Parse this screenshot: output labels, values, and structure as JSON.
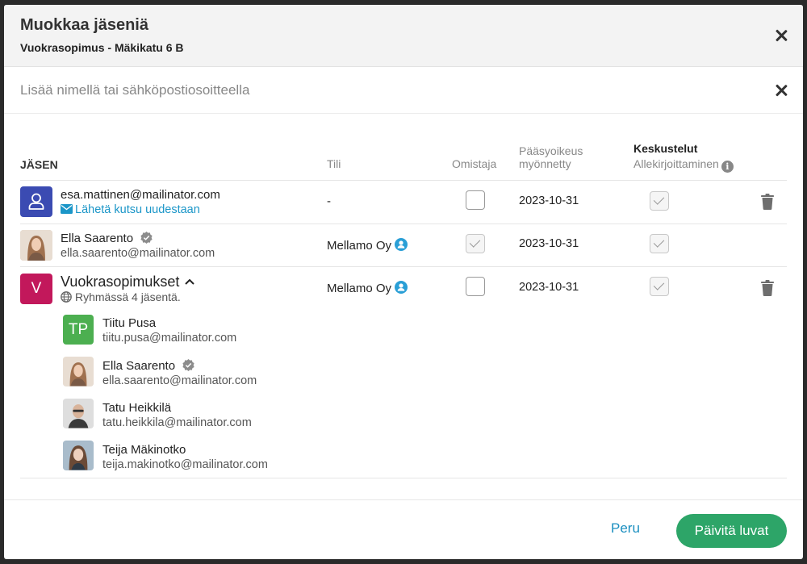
{
  "modal": {
    "title": "Muokkaa jäseniä",
    "subtitle": "Vuokrasopimus - Mäkikatu 6 B"
  },
  "search": {
    "placeholder": "Lisää nimellä tai sähköpostiosoitteella"
  },
  "table": {
    "headers": {
      "member": "JÄSEN",
      "account": "Tili",
      "owner": "Omistaja",
      "access_line1": "Pääsyoikeus",
      "access_line2": "myönnetty",
      "discussions": "Keskustelut",
      "signing": "Allekirjoittaminen"
    },
    "rows": [
      {
        "email": "esa.mattinen@mailinator.com",
        "resend_label": "Lähetä kutsu uudestaan",
        "account": "-",
        "owner_checked": false,
        "date": "2023-10-31",
        "signing_checked": true
      },
      {
        "name": "Ella Saarento",
        "email": "ella.saarento@mailinator.com",
        "account": "Mellamo Oy",
        "owner_checked": true,
        "date": "2023-10-31",
        "signing_checked": true
      },
      {
        "avatar_letter": "V",
        "name": "Vuokrasopimukset",
        "group_info": "Ryhmässä 4 jäsentä.",
        "account": "Mellamo Oy",
        "owner_checked": false,
        "date": "2023-10-31",
        "signing_checked": true
      }
    ],
    "group_members": [
      {
        "initials": "TP",
        "name": "Tiitu Pusa",
        "email": "tiitu.pusa@mailinator.com"
      },
      {
        "name": "Ella Saarento",
        "email": "ella.saarento@mailinator.com"
      },
      {
        "name": "Tatu Heikkilä",
        "email": "tatu.heikkila@mailinator.com"
      },
      {
        "name": "Teija Mäkinotko",
        "email": "teija.makinotko@mailinator.com"
      }
    ]
  },
  "footer": {
    "cancel_label": "Peru",
    "update_label": "Päivitä luvat"
  },
  "colors": {
    "accent_blue": "#1b96c8",
    "primary_green": "#2da568",
    "avatar_blue": "#3b4bb2",
    "avatar_magenta": "#c2185b",
    "avatar_green": "#4caf50"
  }
}
